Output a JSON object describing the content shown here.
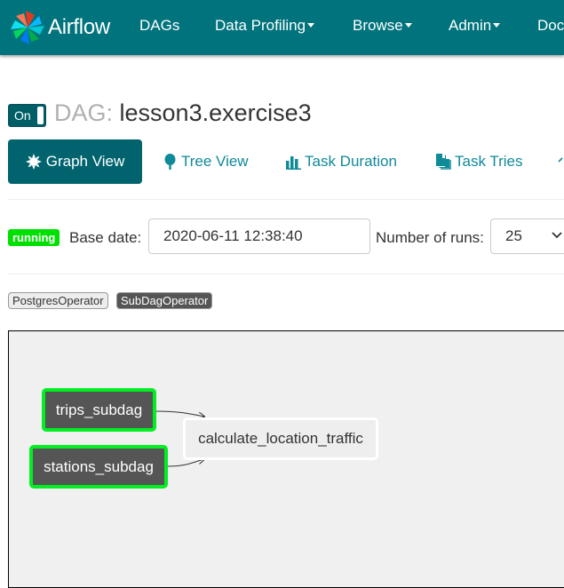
{
  "brand": {
    "name": "Airflow",
    "logo_icon": "pinwheel-icon"
  },
  "nav": {
    "items": [
      "DAGs",
      "Data Profiling",
      "Browse",
      "Admin",
      "Docs"
    ]
  },
  "dag": {
    "toggle": "On",
    "prefix": "DAG:",
    "id": "lesson3.exercise3"
  },
  "tabs": [
    {
      "label": "Graph View",
      "icon": "sun-icon",
      "active": true
    },
    {
      "label": "Tree View",
      "icon": "tree-icon"
    },
    {
      "label": "Task Duration",
      "icon": "bar-chart-icon"
    },
    {
      "label": "Task Tries",
      "icon": "files-icon"
    }
  ],
  "status": {
    "state": "running",
    "base_date_label": "Base date:",
    "base_date": "2020-06-11 12:38:40",
    "runs_label": "Number of runs:",
    "runs": "25"
  },
  "operators": [
    "PostgresOperator",
    "SubDagOperator"
  ],
  "graph": {
    "nodes": [
      "trips_subdag",
      "stations_subdag",
      "calculate_location_traffic"
    ],
    "colors": {
      "running_border": "#00ee22",
      "subdag_fill": "#555555",
      "postgres_fill": "#eeeeee"
    }
  },
  "colors": {
    "navbar": "#00737c",
    "active_tab": "#00636d",
    "link": "#0f8a99",
    "running_badge": "#00e000"
  }
}
